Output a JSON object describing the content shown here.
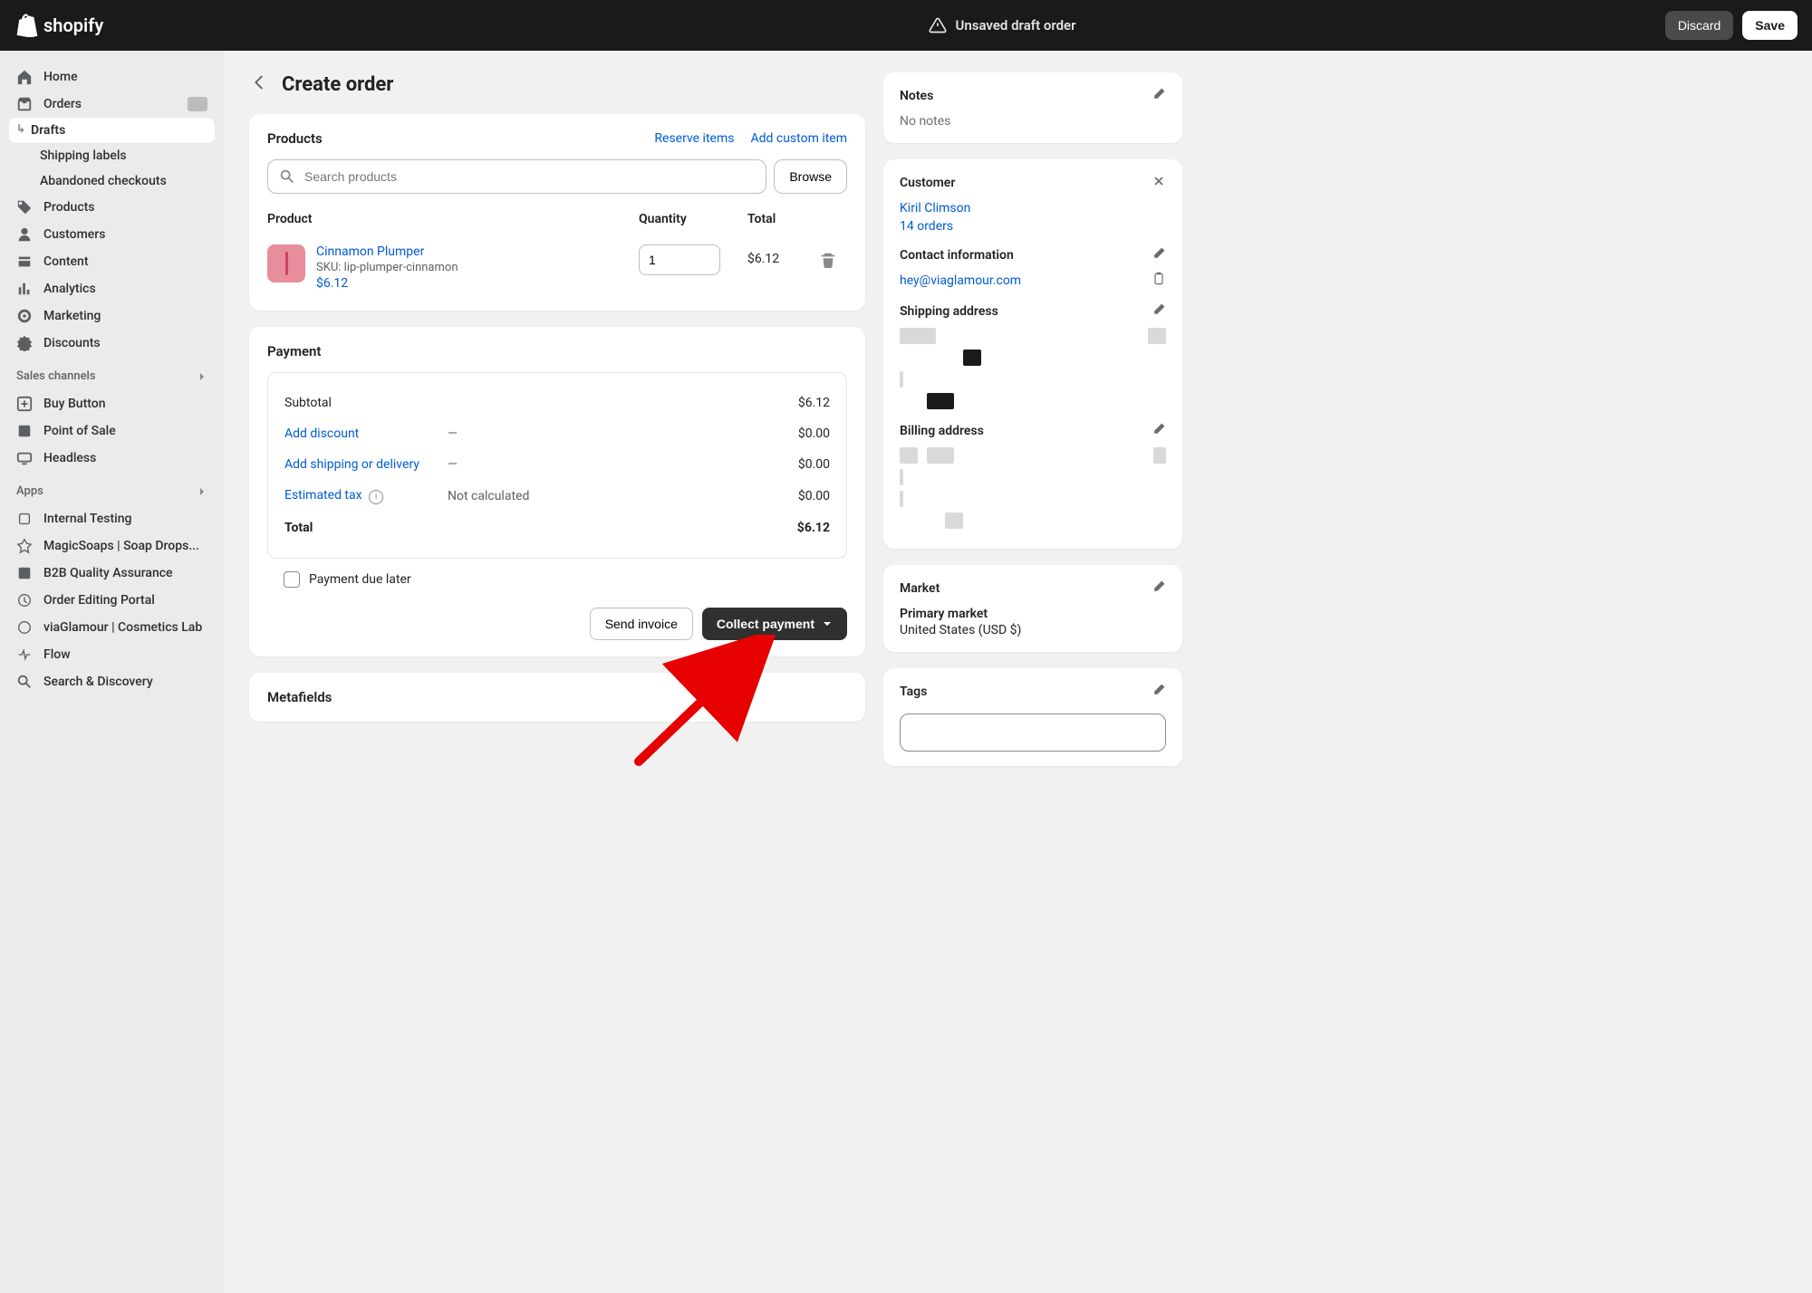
{
  "topbar": {
    "unsaved_label": "Unsaved draft order",
    "discard_label": "Discard",
    "save_label": "Save",
    "brand": "shopify"
  },
  "sidebar": {
    "primary": [
      {
        "label": "Home",
        "icon": "home"
      },
      {
        "label": "Orders",
        "icon": "orders",
        "badge": true
      },
      {
        "label": "Drafts",
        "sub": true,
        "active": true
      },
      {
        "label": "Shipping labels",
        "sub": true
      },
      {
        "label": "Abandoned checkouts",
        "sub": true
      },
      {
        "label": "Products",
        "icon": "tag"
      },
      {
        "label": "Customers",
        "icon": "person"
      },
      {
        "label": "Content",
        "icon": "content"
      },
      {
        "label": "Analytics",
        "icon": "analytics"
      },
      {
        "label": "Marketing",
        "icon": "target"
      },
      {
        "label": "Discounts",
        "icon": "discount"
      }
    ],
    "channels_label": "Sales channels",
    "channels": [
      {
        "label": "Buy Button"
      },
      {
        "label": "Point of Sale"
      },
      {
        "label": "Headless"
      }
    ],
    "apps_label": "Apps",
    "apps": [
      {
        "label": "Internal Testing"
      },
      {
        "label": "MagicSoaps | Soap Drops..."
      },
      {
        "label": "B2B Quality Assurance"
      },
      {
        "label": "Order Editing Portal"
      },
      {
        "label": "viaGlamour | Cosmetics Lab"
      },
      {
        "label": "Flow"
      },
      {
        "label": "Search & Discovery"
      }
    ]
  },
  "page": {
    "title": "Create order"
  },
  "products_card": {
    "title": "Products",
    "reserve_link": "Reserve items",
    "custom_link": "Add custom item",
    "search_placeholder": "Search products",
    "browse_label": "Browse",
    "col_product": "Product",
    "col_qty": "Quantity",
    "col_total": "Total",
    "item": {
      "name": "Cinnamon Plumper",
      "sku": "SKU: lip-plumper-cinnamon",
      "price": "$6.12",
      "qty": "1",
      "total": "$6.12"
    }
  },
  "payment_card": {
    "title": "Payment",
    "subtotal_label": "Subtotal",
    "subtotal_value": "$6.12",
    "discount_link": "Add discount",
    "discount_mid": "—",
    "discount_value": "$0.00",
    "shipping_link": "Add shipping or delivery",
    "shipping_mid": "—",
    "shipping_value": "$0.00",
    "tax_link": "Estimated tax",
    "tax_mid": "Not calculated",
    "tax_value": "$0.00",
    "total_label": "Total",
    "total_value": "$6.12",
    "due_later_label": "Payment due later",
    "send_invoice_label": "Send invoice",
    "collect_label": "Collect payment"
  },
  "metafields_card": {
    "title": "Metafields"
  },
  "notes_card": {
    "title": "Notes",
    "empty": "No notes"
  },
  "customer_card": {
    "title": "Customer",
    "name": "Kiril Climson",
    "orders": "14 orders",
    "contact_title": "Contact information",
    "email": "hey@viaglamour.com",
    "shipping_title": "Shipping address",
    "billing_title": "Billing address"
  },
  "market_card": {
    "title": "Market",
    "primary_label": "Primary market",
    "region": "United States (USD $)"
  },
  "tags_card": {
    "title": "Tags"
  }
}
